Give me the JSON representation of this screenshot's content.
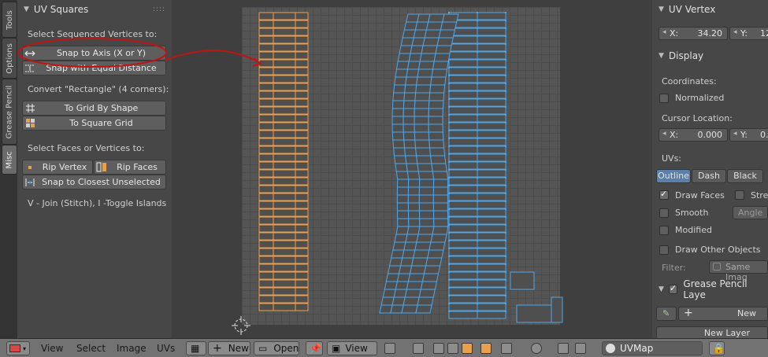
{
  "tabs": [
    "Tools",
    "Options",
    "Grease Pencil",
    "Misc"
  ],
  "left_panel": {
    "title": "UV Squares",
    "section1_label": "Select Sequenced Vertices to:",
    "snap_axis": "Snap to Axis (X or Y)",
    "snap_equal": "Snap with Equal Distance",
    "section2_label": "Convert \"Rectangle\" (4 corners):",
    "grid_by_shape": "To Grid By Shape",
    "square_grid": "To Square Grid",
    "section3_label": "Select Faces or Vertices to:",
    "rip_vertex": "Rip Vertex",
    "rip_faces": "Rip Faces",
    "snap_closest": "Snap to Closest Unselected",
    "hint": "V - Join (Stitch), I -Toggle Islands"
  },
  "right_panel": {
    "uv_vertex_title": "UV Vertex",
    "x_label": "X:",
    "x_value": "34.20",
    "y_label": "Y:",
    "y_value": "12",
    "display_title": "Display",
    "coordinates_label": "Coordinates:",
    "normalized": "Normalized",
    "cursor_location_label": "Cursor Location:",
    "cursor_x_label": "X:",
    "cursor_x": "0.000",
    "cursor_y_label": "Y:",
    "cursor_y": "0.",
    "uvs_label": "UVs:",
    "outline": "Outline",
    "dash": "Dash",
    "black": "Black",
    "draw_faces": "Draw Faces",
    "stretch": "Stre",
    "smooth": "Smooth",
    "angle": "Angle",
    "modified": "Modified",
    "draw_other": "Draw Other Objects",
    "filter_label": "Filter:",
    "filter_value": "Same Imag",
    "grease_title": "Grease Pencil Laye",
    "new_label": "New",
    "new_layer": "New Layer"
  },
  "header": {
    "view": "View",
    "select": "Select",
    "image": "Image",
    "uvs": "UVs",
    "new": "New",
    "open": "Open",
    "view2": "View",
    "uvmap": "UVMap"
  },
  "colors": {
    "accent_orange": "#e8a04a",
    "uv_blue": "#4ea6ea",
    "annotation_red": "#c01414",
    "panel_bg": "#474747"
  }
}
